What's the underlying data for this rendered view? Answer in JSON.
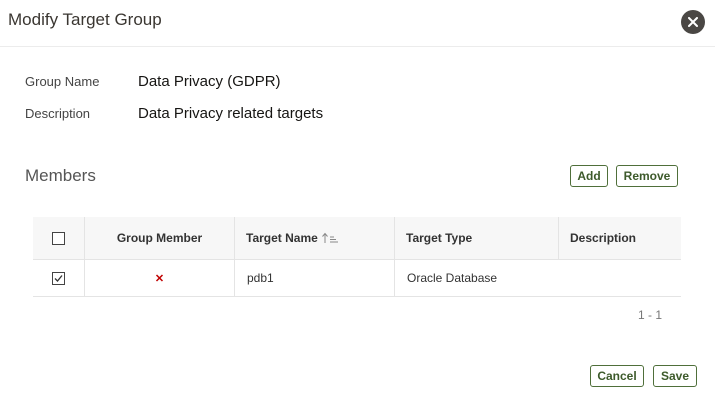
{
  "dialog": {
    "title": "Modify Target Group",
    "close_label": "✕"
  },
  "fields": {
    "group_name_label": "Group Name",
    "group_name_value": "Data Privacy (GDPR)",
    "description_label": "Description",
    "description_value": "Data Privacy related targets"
  },
  "members": {
    "title": "Members",
    "add_label": "Add",
    "remove_label": "Remove",
    "columns": [
      "Group Member",
      "Target Name",
      "Target Type",
      "Description"
    ],
    "rows": [
      {
        "checked": true,
        "group_member": "✕",
        "target_name": "pdb1",
        "target_type": "Oracle Database",
        "description": ""
      }
    ],
    "pagination": "1 - 1"
  },
  "footer": {
    "cancel_label": "Cancel",
    "save_label": "Save"
  },
  "colors": {
    "accent": "#4f6f3a",
    "remove_mark": "#c00000",
    "close_bg": "#4a4744"
  }
}
